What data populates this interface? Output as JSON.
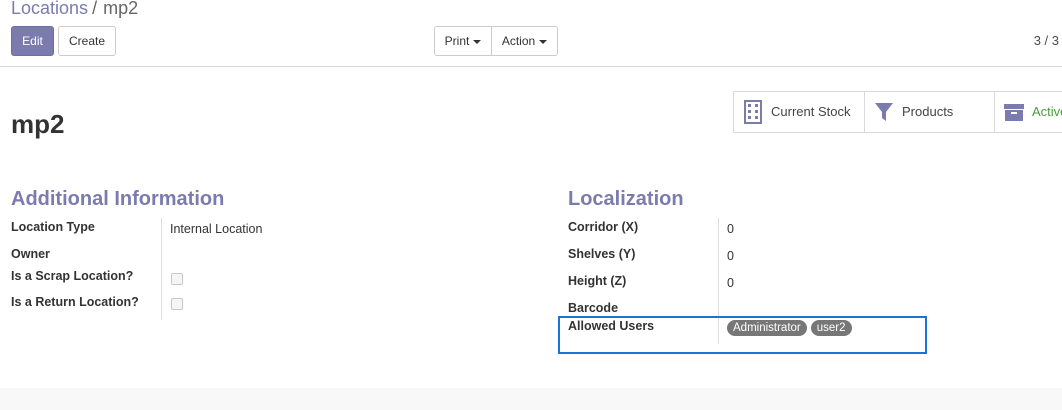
{
  "breadcrumb": {
    "parent": "Locations",
    "separator": "/",
    "current": "mp2"
  },
  "toolbar": {
    "edit_label": "Edit",
    "create_label": "Create",
    "print_label": "Print",
    "action_label": "Action",
    "pager": "3 / 3"
  },
  "record": {
    "title": "mp2"
  },
  "smart_buttons": [
    {
      "label": "Current Stock",
      "icon": "building-icon"
    },
    {
      "label": "Products",
      "icon": "filter-icon"
    },
    {
      "label": "Active",
      "icon": "archive-icon"
    }
  ],
  "additional_info": {
    "title": "Additional Information",
    "fields": [
      {
        "label": "Location Type",
        "value": "Internal Location"
      },
      {
        "label": "Owner",
        "value": ""
      },
      {
        "label": "Is a Scrap Location?",
        "checked": false
      },
      {
        "label": "Is a Return Location?",
        "checked": false
      }
    ]
  },
  "localization": {
    "title": "Localization",
    "fields": [
      {
        "label": "Corridor (X)",
        "value": "0"
      },
      {
        "label": "Shelves (Y)",
        "value": "0"
      },
      {
        "label": "Height (Z)",
        "value": "0"
      },
      {
        "label": "Barcode",
        "value": ""
      },
      {
        "label": "Allowed Users",
        "tags": [
          "Administrator",
          "user2"
        ]
      }
    ]
  },
  "colors": {
    "brand": "#7c7bad",
    "active": "#4c9b40",
    "highlight": "#1a74d4",
    "tag": "#777777"
  }
}
